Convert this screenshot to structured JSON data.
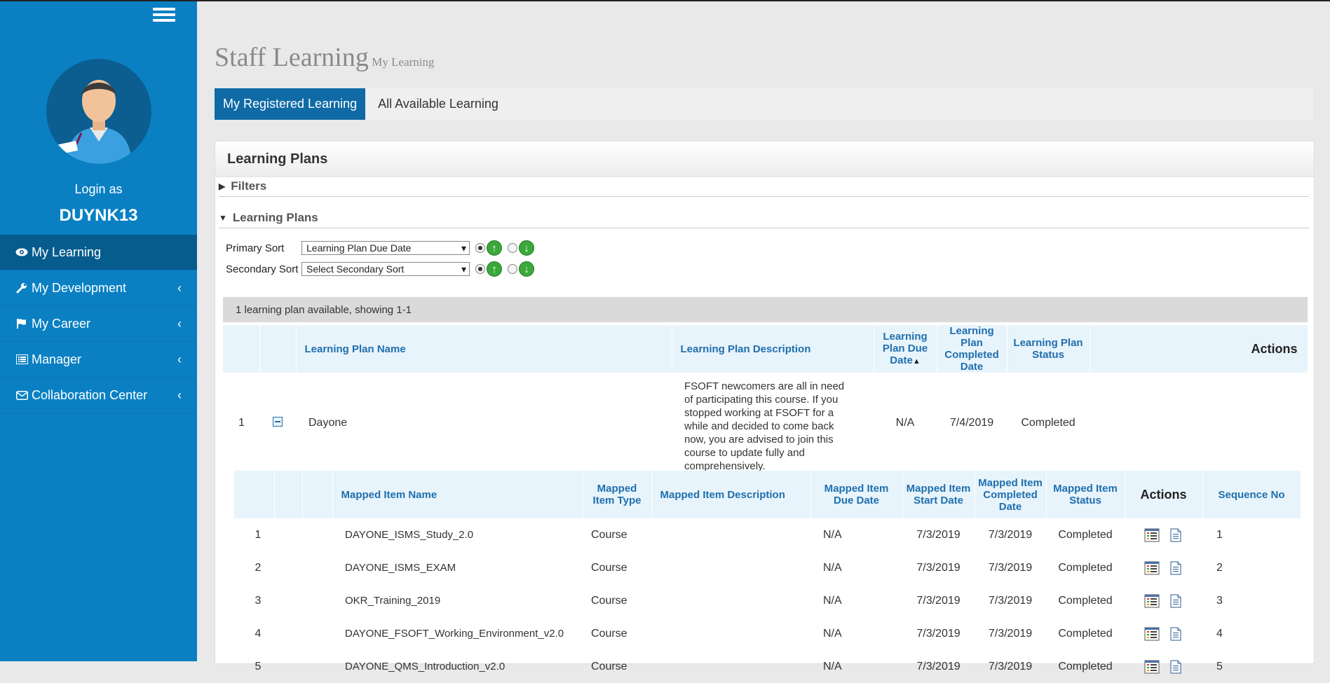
{
  "sidebar": {
    "login_label": "Login as",
    "username": "DUYNK13",
    "items": [
      {
        "label": "My Learning",
        "icon": "eye-icon",
        "active": true
      },
      {
        "label": "My Development",
        "icon": "wrench-icon"
      },
      {
        "label": "My Career",
        "icon": "flag-icon"
      },
      {
        "label": "Manager",
        "icon": "list-icon"
      },
      {
        "label": "Collaboration Center",
        "icon": "envelope-icon"
      }
    ]
  },
  "header": {
    "title": "Staff Learning",
    "subtitle": "My Learning"
  },
  "tabs": [
    {
      "label": "My Registered Learning",
      "active": true
    },
    {
      "label": "All Available Learning"
    }
  ],
  "panel": {
    "title": "Learning Plans",
    "filters_label": "Filters",
    "plans_label": "Learning Plans",
    "primary_sort": {
      "label": "Primary Sort",
      "value": "Learning Plan Due Date"
    },
    "secondary_sort": {
      "label": "Secondary Sort",
      "value": "Select Secondary Sort"
    },
    "count_text": "1 learning plan available, showing 1-1"
  },
  "plan_table": {
    "headers": {
      "name": "Learning Plan Name",
      "description": "Learning Plan Description",
      "due": "Learning Plan Due Date",
      "completed": "Learning Plan Completed Date",
      "status": "Learning Plan Status",
      "actions": "Actions"
    },
    "row": {
      "no": "1",
      "name": "Dayone",
      "description": "FSOFT newcomers are all in need of participating this course. If you stopped working at FSOFT for a while and decided to come back now, you are advised to join this course to update fully and comprehensively.",
      "due": "N/A",
      "completed": "7/4/2019",
      "status": "Completed"
    }
  },
  "mapped_table": {
    "headers": {
      "name": "Mapped Item Name",
      "type": "Mapped Item Type",
      "description": "Mapped Item Description",
      "due": "Mapped Item Due Date",
      "start": "Mapped Item Start Date",
      "completed": "Mapped Item Completed Date",
      "status": "Mapped Item Status",
      "actions": "Actions",
      "seq": "Sequence No"
    },
    "rows": [
      {
        "no": "1",
        "name": "DAYONE_ISMS_Study_2.0",
        "type": "Course",
        "due": "N/A",
        "start": "7/3/2019",
        "completed": "7/3/2019",
        "status": "Completed",
        "seq": "1"
      },
      {
        "no": "2",
        "name": "DAYONE_ISMS_EXAM",
        "type": "Course",
        "due": "N/A",
        "start": "7/3/2019",
        "completed": "7/3/2019",
        "status": "Completed",
        "seq": "2"
      },
      {
        "no": "3",
        "name": "OKR_Training_2019",
        "type": "Course",
        "due": "N/A",
        "start": "7/3/2019",
        "completed": "7/3/2019",
        "status": "Completed",
        "seq": "3"
      },
      {
        "no": "4",
        "name": "DAYONE_FSOFT_Working_Environment_v2.0",
        "type": "Course",
        "due": "N/A",
        "start": "7/3/2019",
        "completed": "7/3/2019",
        "status": "Completed",
        "seq": "4"
      },
      {
        "no": "5",
        "name": "DAYONE_QMS_Introduction_v2.0",
        "type": "Course",
        "due": "N/A",
        "start": "7/3/2019",
        "completed": "7/3/2019",
        "status": "Completed",
        "seq": "5"
      }
    ]
  }
}
